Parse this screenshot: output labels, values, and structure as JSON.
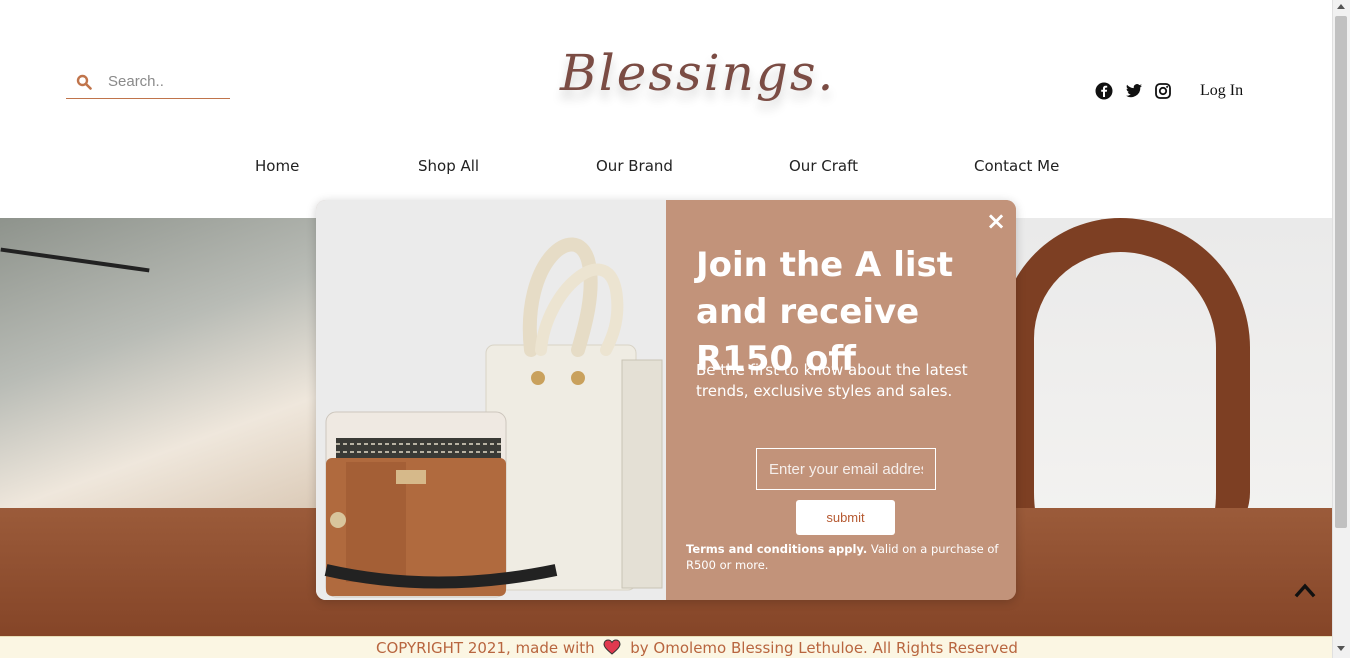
{
  "header": {
    "search_placeholder": "Search..",
    "logo_text": "Blessings.",
    "login_label": "Log In"
  },
  "nav": {
    "items": [
      "Home",
      "Shop All",
      "Our Brand",
      "Our Craft",
      "Contact Me"
    ]
  },
  "popup": {
    "close_label": "×",
    "headline": "Join the A list and receive R150 off",
    "subtext": "Be the first to know about the latest trends, exclusive styles and sales.",
    "email_placeholder": "Enter your email address",
    "submit_label": "submit",
    "terms_bold": "Terms and conditions apply.",
    "terms_rest": "Valid on a purchase of R500 or more."
  },
  "footer": {
    "text_before": "COPYRIGHT 2021, made with",
    "text_after": "by Omolemo Blessing Lethuloe. All Rights Reserved"
  },
  "colors": {
    "accent": "#c2937a",
    "brand_text": "#7b4c44",
    "footer_text": "#b8653f",
    "search_accent": "#c0744b"
  },
  "icons": [
    "search-icon",
    "facebook-icon",
    "twitter-icon",
    "instagram-icon",
    "close-icon",
    "heart-icon",
    "chevron-up-icon"
  ]
}
